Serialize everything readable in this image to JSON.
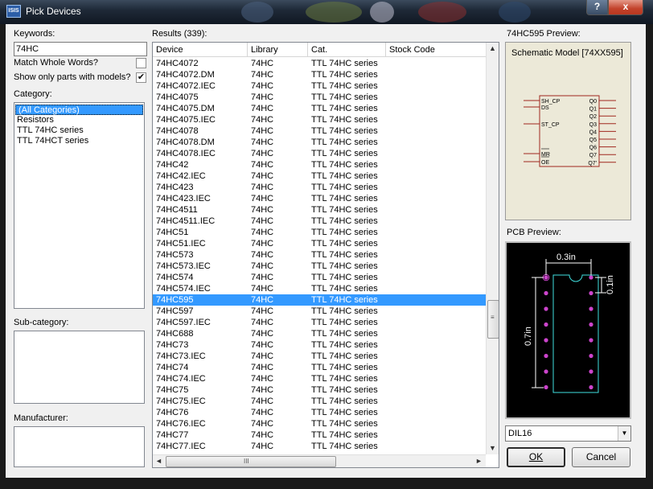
{
  "window": {
    "title": "Pick Devices",
    "app_icon": "ISIS",
    "help_label": "?",
    "close_label": "x"
  },
  "left": {
    "keywords_label": "Keywords:",
    "keywords_value": "74HC",
    "match_whole_words": {
      "label": "Match Whole Words?",
      "checked": false,
      "mark": ""
    },
    "show_only_models": {
      "label": "Show only parts with models?",
      "checked": true,
      "mark": "✔"
    },
    "category_label": "Category:",
    "categories": [
      "(All Categories)",
      "Resistors",
      "TTL 74HC series",
      "TTL 74HCT series"
    ],
    "selected_category": "(All Categories)",
    "subcategory_label": "Sub-category:",
    "manufacturer_label": "Manufacturer:"
  },
  "results": {
    "label": "Results (339):",
    "columns": [
      "Device",
      "Library",
      "Cat.",
      "Stock Code"
    ],
    "selected_device": "74HC595",
    "rows": [
      [
        "74HC4072",
        "74HC",
        "TTL 74HC series",
        ""
      ],
      [
        "74HC4072.DM",
        "74HC",
        "TTL 74HC series",
        ""
      ],
      [
        "74HC4072.IEC",
        "74HC",
        "TTL 74HC series",
        ""
      ],
      [
        "74HC4075",
        "74HC",
        "TTL 74HC series",
        ""
      ],
      [
        "74HC4075.DM",
        "74HC",
        "TTL 74HC series",
        ""
      ],
      [
        "74HC4075.IEC",
        "74HC",
        "TTL 74HC series",
        ""
      ],
      [
        "74HC4078",
        "74HC",
        "TTL 74HC series",
        ""
      ],
      [
        "74HC4078.DM",
        "74HC",
        "TTL 74HC series",
        ""
      ],
      [
        "74HC4078.IEC",
        "74HC",
        "TTL 74HC series",
        ""
      ],
      [
        "74HC42",
        "74HC",
        "TTL 74HC series",
        ""
      ],
      [
        "74HC42.IEC",
        "74HC",
        "TTL 74HC series",
        ""
      ],
      [
        "74HC423",
        "74HC",
        "TTL 74HC series",
        ""
      ],
      [
        "74HC423.IEC",
        "74HC",
        "TTL 74HC series",
        ""
      ],
      [
        "74HC4511",
        "74HC",
        "TTL 74HC series",
        ""
      ],
      [
        "74HC4511.IEC",
        "74HC",
        "TTL 74HC series",
        ""
      ],
      [
        "74HC51",
        "74HC",
        "TTL 74HC series",
        ""
      ],
      [
        "74HC51.IEC",
        "74HC",
        "TTL 74HC series",
        ""
      ],
      [
        "74HC573",
        "74HC",
        "TTL 74HC series",
        ""
      ],
      [
        "74HC573.IEC",
        "74HC",
        "TTL 74HC series",
        ""
      ],
      [
        "74HC574",
        "74HC",
        "TTL 74HC series",
        ""
      ],
      [
        "74HC574.IEC",
        "74HC",
        "TTL 74HC series",
        ""
      ],
      [
        "74HC595",
        "74HC",
        "TTL 74HC series",
        ""
      ],
      [
        "74HC597",
        "74HC",
        "TTL 74HC series",
        ""
      ],
      [
        "74HC597.IEC",
        "74HC",
        "TTL 74HC series",
        ""
      ],
      [
        "74HC688",
        "74HC",
        "TTL 74HC series",
        ""
      ],
      [
        "74HC73",
        "74HC",
        "TTL 74HC series",
        ""
      ],
      [
        "74HC73.IEC",
        "74HC",
        "TTL 74HC series",
        ""
      ],
      [
        "74HC74",
        "74HC",
        "TTL 74HC series",
        ""
      ],
      [
        "74HC74.IEC",
        "74HC",
        "TTL 74HC series",
        ""
      ],
      [
        "74HC75",
        "74HC",
        "TTL 74HC series",
        ""
      ],
      [
        "74HC75.IEC",
        "74HC",
        "TTL 74HC series",
        ""
      ],
      [
        "74HC76",
        "74HC",
        "TTL 74HC series",
        ""
      ],
      [
        "74HC76.IEC",
        "74HC",
        "TTL 74HC series",
        ""
      ],
      [
        "74HC77",
        "74HC",
        "TTL 74HC series",
        ""
      ],
      [
        "74HC77.IEC",
        "74HC",
        "TTL 74HC series",
        ""
      ]
    ]
  },
  "preview": {
    "title": "74HC595 Preview:",
    "schematic_model": "Schematic Model [74XX595]",
    "left_pins": [
      "SH_CP",
      "DS",
      "ST_CP",
      "MR",
      "OE"
    ],
    "right_pins": [
      "Q0",
      "Q1",
      "Q2",
      "Q3",
      "Q4",
      "Q5",
      "Q6",
      "Q7",
      "Q7'"
    ],
    "schematic_color": "#a0281e",
    "pcb_label": "PCB Preview:",
    "pcb_width_label": "0.3in",
    "pcb_pitch_label": "0.1in",
    "pcb_height_label": "0.7in",
    "pcb_pad_color": "#cc44cc",
    "pcb_outline_color": "#40e0e0",
    "package": "DIL16",
    "package_arrow": "▼"
  },
  "buttons": {
    "ok": "OK",
    "cancel": "Cancel"
  },
  "scroll": {
    "up": "▲",
    "down": "▼",
    "left": "◄",
    "right": "►",
    "vgrip": "≡",
    "hgrip": "III"
  }
}
